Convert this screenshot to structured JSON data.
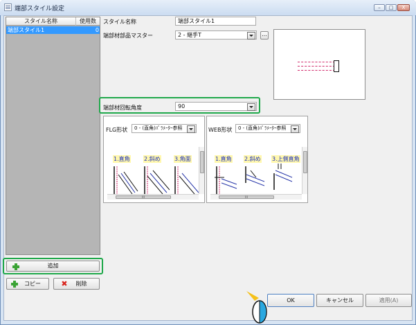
{
  "window": {
    "title": "端部スタイル設定"
  },
  "list": {
    "headers": {
      "name": "スタイル名称",
      "used": "使用数"
    },
    "rows": [
      {
        "name": "端部スタイル1",
        "used": "0"
      }
    ]
  },
  "fields": {
    "style_name_label": "スタイル名称",
    "style_name_value": "端部スタイル1",
    "master_label": "端部材部品マスター",
    "master_value": "2 - 継手T",
    "browse_label": "...",
    "angle_label": "端部材回転角度",
    "angle_value": "90"
  },
  "flg": {
    "label": "FLG形状",
    "select_value": "0 - (直角)ﾊﾟﾗﾒｰﾀｰ参照",
    "thumbs": [
      "1.直角",
      "2.斜め",
      "3.角面"
    ],
    "scroll_grip": "III"
  },
  "web": {
    "label": "WEB形状",
    "select_value": "0 - (直角)ﾊﾟﾗﾒｰﾀｰ参照",
    "thumbs": [
      "1.直角",
      "2.斜め",
      "3.上側直角"
    ],
    "scroll_grip": "III"
  },
  "buttons": {
    "add": "追加",
    "copy": "コピー",
    "delete": "削除",
    "ok": "OK",
    "cancel": "キャンセル",
    "apply": "適用(A)",
    "minimize": "–",
    "maximize": "□",
    "close": "X"
  },
  "colors": {
    "selection": "#3399ff",
    "highlight_frame": "#1fa84a",
    "thumb_label_bg": "#fff7ad",
    "preview_line": "#d12a6b"
  }
}
